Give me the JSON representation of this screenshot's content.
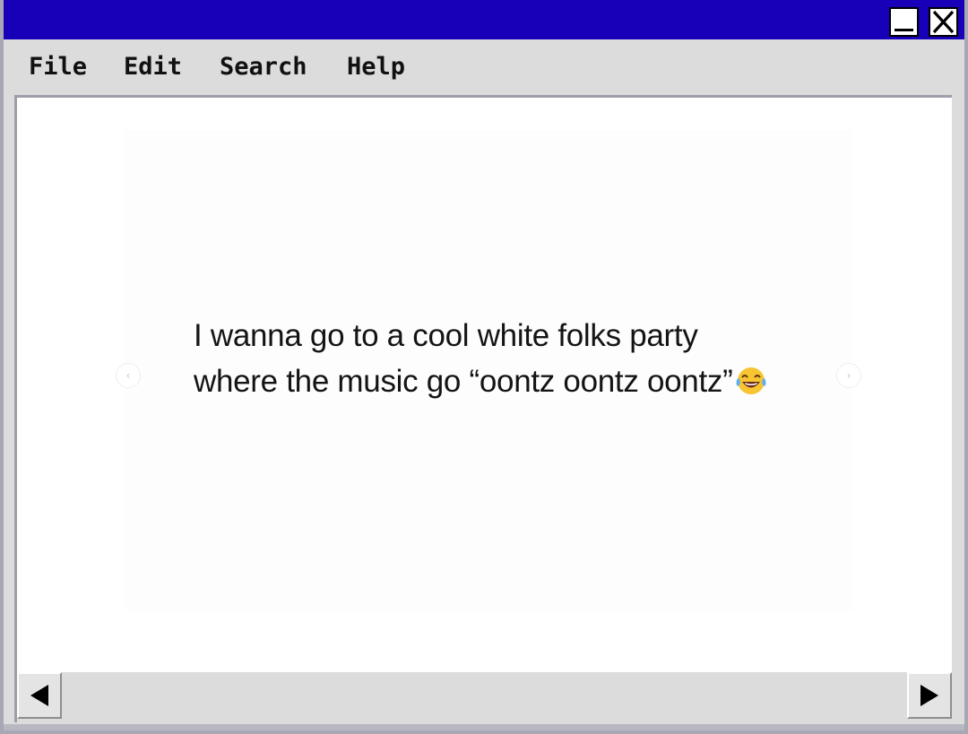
{
  "window": {
    "titlebar_color": "#1800b8",
    "controls": {
      "minimize_icon": "minimize-icon",
      "close_icon": "close-icon"
    }
  },
  "menubar": {
    "items": [
      {
        "label": "File"
      },
      {
        "label": "Edit"
      },
      {
        "label": "Search"
      },
      {
        "label": "Help"
      }
    ]
  },
  "content": {
    "tweet_text": "I wanna go to a cool white folks party where the music go “oontz oontz oontz”",
    "emoji_icon": "face-with-tears-of-joy-icon",
    "nav_prev_icon": "chevron-left-icon",
    "nav_next_icon": "chevron-right-icon"
  },
  "scrollbar": {
    "left_icon": "arrow-left-icon",
    "right_icon": "arrow-right-icon"
  }
}
